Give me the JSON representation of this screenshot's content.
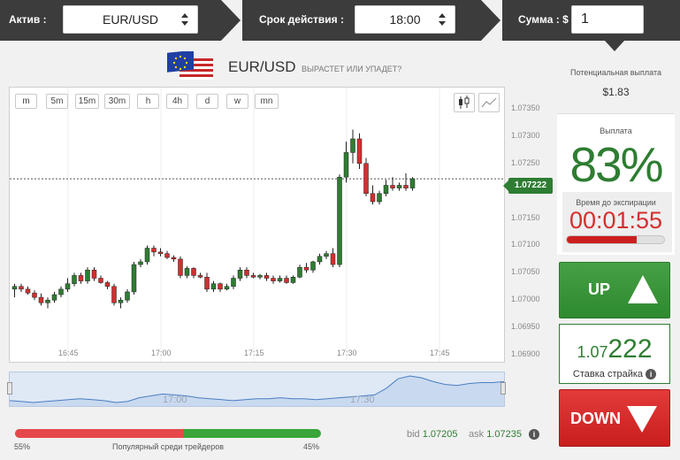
{
  "topbar": {
    "asset_label": "Актив :",
    "asset_value": "EUR/USD",
    "expiry_label": "Срок действия :",
    "expiry_value": "18:00",
    "amount_label": "Сумма : $",
    "amount_value": "1"
  },
  "header": {
    "pair": "EUR/USD",
    "question": "ВЫРАСТЕТ ИЛИ УПАДЕТ?"
  },
  "chart_controls": {
    "timeframes": [
      "m",
      "5m",
      "15m",
      "30m",
      "h",
      "4h",
      "d",
      "w",
      "mn"
    ],
    "chart_types": [
      "candlestick-icon",
      "line-chart-icon"
    ]
  },
  "chart_data": {
    "type": "candlestick",
    "x_tick_labels": [
      "16:45",
      "17:00",
      "17:15",
      "17:30",
      "17:45"
    ],
    "y_tick_labels": [
      "1.07350",
      "1.07300",
      "1.07250",
      "1.07200",
      "1.07150",
      "1.07100",
      "1.07050",
      "1.07000",
      "1.06950",
      "1.06900"
    ],
    "ylim": [
      1.069,
      1.0735
    ],
    "current_price": "1.07222",
    "current_price_value": 1.07222,
    "navigator_labels": [
      "17:00",
      "17:30"
    ],
    "candles": [
      {
        "o": 1.0702,
        "h": 1.0703,
        "l": 1.07005,
        "c": 1.07025
      },
      {
        "o": 1.07025,
        "h": 1.0703,
        "l": 1.07015,
        "c": 1.0702
      },
      {
        "o": 1.0702,
        "h": 1.07025,
        "l": 1.0701,
        "c": 1.07013
      },
      {
        "o": 1.07013,
        "h": 1.07018,
        "l": 1.07,
        "c": 1.07005
      },
      {
        "o": 1.07005,
        "h": 1.07012,
        "l": 1.0699,
        "c": 1.06995
      },
      {
        "o": 1.06995,
        "h": 1.07005,
        "l": 1.06985,
        "c": 1.07
      },
      {
        "o": 1.07,
        "h": 1.07015,
        "l": 1.06995,
        "c": 1.0701
      },
      {
        "o": 1.0701,
        "h": 1.07025,
        "l": 1.07005,
        "c": 1.0702
      },
      {
        "o": 1.0702,
        "h": 1.0704,
        "l": 1.07015,
        "c": 1.0703
      },
      {
        "o": 1.0703,
        "h": 1.0705,
        "l": 1.07025,
        "c": 1.07045
      },
      {
        "o": 1.07045,
        "h": 1.0705,
        "l": 1.0703,
        "c": 1.07035
      },
      {
        "o": 1.07035,
        "h": 1.0706,
        "l": 1.0703,
        "c": 1.07055
      },
      {
        "o": 1.07055,
        "h": 1.0706,
        "l": 1.07035,
        "c": 1.0704
      },
      {
        "o": 1.0704,
        "h": 1.07045,
        "l": 1.0703,
        "c": 1.07032
      },
      {
        "o": 1.07032,
        "h": 1.07035,
        "l": 1.0702,
        "c": 1.07025
      },
      {
        "o": 1.07025,
        "h": 1.0703,
        "l": 1.0699,
        "c": 1.06995
      },
      {
        "o": 1.06995,
        "h": 1.07005,
        "l": 1.06985,
        "c": 1.07
      },
      {
        "o": 1.07,
        "h": 1.0702,
        "l": 1.06995,
        "c": 1.07015
      },
      {
        "o": 1.07015,
        "h": 1.0707,
        "l": 1.0701,
        "c": 1.07065
      },
      {
        "o": 1.07065,
        "h": 1.07075,
        "l": 1.0706,
        "c": 1.0707
      },
      {
        "o": 1.0707,
        "h": 1.071,
        "l": 1.07065,
        "c": 1.07095
      },
      {
        "o": 1.07095,
        "h": 1.071,
        "l": 1.0708,
        "c": 1.07088
      },
      {
        "o": 1.07088,
        "h": 1.07095,
        "l": 1.0708,
        "c": 1.07085
      },
      {
        "o": 1.07085,
        "h": 1.0709,
        "l": 1.07075,
        "c": 1.07078
      },
      {
        "o": 1.07078,
        "h": 1.07082,
        "l": 1.0707,
        "c": 1.07075
      },
      {
        "o": 1.07075,
        "h": 1.0708,
        "l": 1.0704,
        "c": 1.07045
      },
      {
        "o": 1.07045,
        "h": 1.07062,
        "l": 1.0704,
        "c": 1.07058
      },
      {
        "o": 1.07058,
        "h": 1.0706,
        "l": 1.0704,
        "c": 1.07045
      },
      {
        "o": 1.07045,
        "h": 1.0705,
        "l": 1.0704,
        "c": 1.07042
      },
      {
        "o": 1.07042,
        "h": 1.0705,
        "l": 1.07015,
        "c": 1.0702
      },
      {
        "o": 1.0702,
        "h": 1.07035,
        "l": 1.07015,
        "c": 1.0703
      },
      {
        "o": 1.0703,
        "h": 1.07032,
        "l": 1.07015,
        "c": 1.0702
      },
      {
        "o": 1.0702,
        "h": 1.0703,
        "l": 1.07018,
        "c": 1.07025
      },
      {
        "o": 1.07025,
        "h": 1.07045,
        "l": 1.0702,
        "c": 1.0704
      },
      {
        "o": 1.0704,
        "h": 1.0706,
        "l": 1.07035,
        "c": 1.07055
      },
      {
        "o": 1.07055,
        "h": 1.0706,
        "l": 1.0704,
        "c": 1.07045
      },
      {
        "o": 1.07045,
        "h": 1.0705,
        "l": 1.0704,
        "c": 1.07042
      },
      {
        "o": 1.07042,
        "h": 1.07048,
        "l": 1.07038,
        "c": 1.07045
      },
      {
        "o": 1.07045,
        "h": 1.0705,
        "l": 1.07035,
        "c": 1.0704
      },
      {
        "o": 1.0704,
        "h": 1.07045,
        "l": 1.0703,
        "c": 1.07035
      },
      {
        "o": 1.07035,
        "h": 1.07045,
        "l": 1.07032,
        "c": 1.0704
      },
      {
        "o": 1.0704,
        "h": 1.07045,
        "l": 1.0703,
        "c": 1.07032
      },
      {
        "o": 1.07032,
        "h": 1.07045,
        "l": 1.0703,
        "c": 1.07042
      },
      {
        "o": 1.07042,
        "h": 1.07065,
        "l": 1.0704,
        "c": 1.0706
      },
      {
        "o": 1.0706,
        "h": 1.07068,
        "l": 1.0705,
        "c": 1.07055
      },
      {
        "o": 1.07055,
        "h": 1.07072,
        "l": 1.0705,
        "c": 1.0707
      },
      {
        "o": 1.0707,
        "h": 1.07085,
        "l": 1.07065,
        "c": 1.0708
      },
      {
        "o": 1.0708,
        "h": 1.0709,
        "l": 1.07075,
        "c": 1.07085
      },
      {
        "o": 1.07085,
        "h": 1.07095,
        "l": 1.0706,
        "c": 1.07065
      },
      {
        "o": 1.07065,
        "h": 1.0723,
        "l": 1.0706,
        "c": 1.07225
      },
      {
        "o": 1.07225,
        "h": 1.0729,
        "l": 1.07215,
        "c": 1.0727
      },
      {
        "o": 1.0727,
        "h": 1.07312,
        "l": 1.0725,
        "c": 1.07295
      },
      {
        "o": 1.07295,
        "h": 1.07305,
        "l": 1.0724,
        "c": 1.0725
      },
      {
        "o": 1.0725,
        "h": 1.0726,
        "l": 1.0719,
        "c": 1.07195
      },
      {
        "o": 1.07195,
        "h": 1.0721,
        "l": 1.07175,
        "c": 1.0718
      },
      {
        "o": 1.0718,
        "h": 1.072,
        "l": 1.07175,
        "c": 1.07195
      },
      {
        "o": 1.07195,
        "h": 1.0722,
        "l": 1.0719,
        "c": 1.0721
      },
      {
        "o": 1.0721,
        "h": 1.07225,
        "l": 1.072,
        "c": 1.07205
      },
      {
        "o": 1.07205,
        "h": 1.07215,
        "l": 1.072,
        "c": 1.0721
      },
      {
        "o": 1.0721,
        "h": 1.07232,
        "l": 1.072,
        "c": 1.07205
      },
      {
        "o": 1.07205,
        "h": 1.07225,
        "l": 1.072,
        "c": 1.07222
      }
    ],
    "navigator_values": [
      1.0702,
      1.0701,
      1.07,
      1.0701,
      1.0702,
      1.0703,
      1.0704,
      1.0703,
      1.0702,
      1.07,
      1.0701,
      1.0705,
      1.0707,
      1.0709,
      1.0708,
      1.0707,
      1.0705,
      1.0704,
      1.0703,
      1.0702,
      1.0703,
      1.0704,
      1.0704,
      1.0705,
      1.0704,
      1.0704,
      1.0703,
      1.0704,
      1.0705,
      1.0706,
      1.0707,
      1.0708,
      1.0715,
      1.0725,
      1.0728,
      1.0726,
      1.0722,
      1.0719,
      1.0718,
      1.072,
      1.0721,
      1.0721,
      1.0722
    ]
  },
  "sentiment": {
    "left_pct": "55%",
    "right_pct": "45%",
    "label": "Популярный среди трейдеров",
    "down_share": 0.55,
    "bid_label": "bid",
    "bid_value": "1.07205",
    "ask_label": "ask",
    "ask_value": "1.07235"
  },
  "panel": {
    "potential_label": "Потенциальная выплата",
    "potential_value": "$1.83",
    "payout_label": "Выплата",
    "payout_value": "83%",
    "expiry_label": "Время до экспирации",
    "countdown": "00:01:55",
    "countdown_progress": 0.72,
    "up_label": "UP",
    "strike_small": "1.07",
    "strike_big": "222",
    "strike_label": "Ставка страйка",
    "down_label": "DOWN"
  },
  "colors": {
    "up": "#2e7d32",
    "down": "#d32f2f",
    "topbar": "#3c3c3c"
  }
}
